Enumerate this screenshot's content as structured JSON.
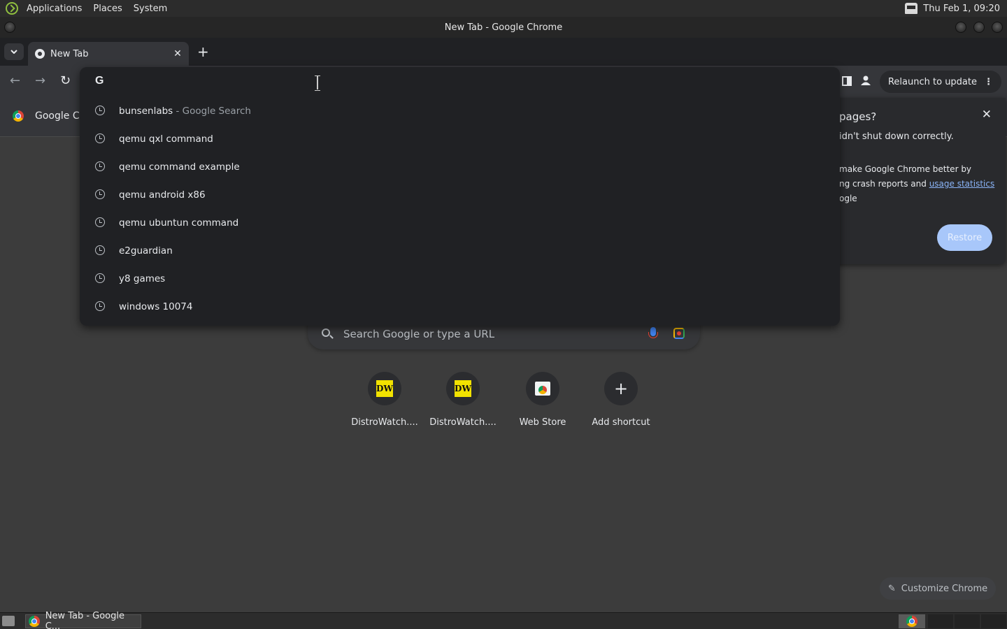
{
  "system_panel": {
    "menus": [
      "Applications",
      "Places",
      "System"
    ],
    "clock": "Thu Feb 1, 09:20"
  },
  "window": {
    "title": "New Tab - Google Chrome"
  },
  "tabs": [
    {
      "label": "New Tab",
      "close": "✕"
    }
  ],
  "toolbar": {
    "relaunch_label": "Relaunch to update"
  },
  "bookmarks": [
    {
      "label": "Google Ch"
    }
  ],
  "restore_popup": {
    "heading": "pages?",
    "line1": "idn't shut down correctly.",
    "line2": "make Google Chrome better by",
    "line3_prefix": "ng crash reports and ",
    "line3_link": "usage statistics",
    "line4": "ogle",
    "button": "Restore"
  },
  "omnibox": {
    "engine_letter": "G",
    "suggestions": [
      {
        "text": "bunsenlabs",
        "suffix": " - Google Search"
      },
      {
        "text": "qemu qxl command",
        "suffix": ""
      },
      {
        "text": "qemu command example",
        "suffix": ""
      },
      {
        "text": "qemu android x86",
        "suffix": ""
      },
      {
        "text": "qemu ubuntun command",
        "suffix": ""
      },
      {
        "text": "e2guardian",
        "suffix": ""
      },
      {
        "text": "y8 games",
        "suffix": ""
      },
      {
        "text": "windows 10074",
        "suffix": ""
      }
    ]
  },
  "search": {
    "placeholder": "Search Google or type a URL"
  },
  "shortcuts": [
    {
      "label": "DistroWatch....",
      "icon": "DW"
    },
    {
      "label": "DistroWatch....",
      "icon": "DW"
    },
    {
      "label": "Web Store",
      "icon": "webstore-icon"
    },
    {
      "label": "Add shortcut",
      "icon": "plus-icon"
    }
  ],
  "customize": {
    "label": "Customize Chrome"
  },
  "taskbar": {
    "task_label": "New Tab - Google C..."
  }
}
